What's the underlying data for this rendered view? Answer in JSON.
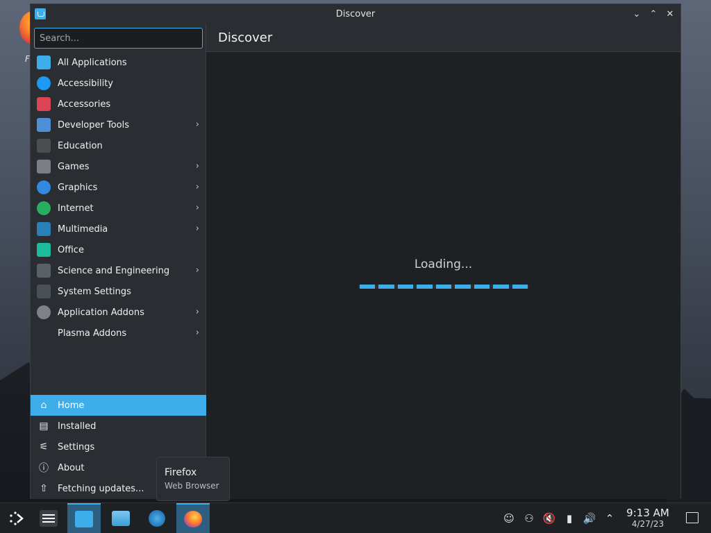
{
  "window": {
    "title": "Discover",
    "controls": {
      "minimize": "⌄",
      "maximize": "⌃",
      "close": "✕"
    }
  },
  "sidebar": {
    "search_placeholder": "Search...",
    "categories": [
      {
        "label": "All Applications",
        "icon": "grid-icon",
        "color": "#3daee9",
        "has_children": false
      },
      {
        "label": "Accessibility",
        "icon": "accessibility-icon",
        "color": "#1d99f3",
        "has_children": false
      },
      {
        "label": "Accessories",
        "icon": "toolbox-icon",
        "color": "#da4453",
        "has_children": false
      },
      {
        "label": "Developer Tools",
        "icon": "hammer-icon",
        "color": "#4f8fd8",
        "has_children": true
      },
      {
        "label": "Education",
        "icon": "chalkboard-icon",
        "color": "#4d4d4d",
        "has_children": false
      },
      {
        "label": "Games",
        "icon": "gamepad-icon",
        "color": "#7a7f85",
        "has_children": true
      },
      {
        "label": "Graphics",
        "icon": "graphics-icon",
        "color": "#2f8ae0",
        "has_children": true
      },
      {
        "label": "Internet",
        "icon": "globe-icon",
        "color": "#27ae60",
        "has_children": true
      },
      {
        "label": "Multimedia",
        "icon": "multimedia-icon",
        "color": "#2980b9",
        "has_children": true
      },
      {
        "label": "Office",
        "icon": "office-icon",
        "color": "#1abc9c",
        "has_children": false
      },
      {
        "label": "Science and Engineering",
        "icon": "flask-icon",
        "color": "#5a6068",
        "has_children": true
      },
      {
        "label": "System Settings",
        "icon": "settings-sliders-icon",
        "color": "#4a5058",
        "has_children": false
      },
      {
        "label": "Application Addons",
        "icon": "addons-icon",
        "color": "#7d8287",
        "has_children": true
      },
      {
        "label": "Plasma Addons",
        "icon": "plasma-icon",
        "color": "#2a2e32",
        "has_children": true
      }
    ],
    "chevron": "›",
    "bottom_nav": [
      {
        "label": "Home",
        "icon": "home-icon",
        "glyph": "⌂",
        "active": true
      },
      {
        "label": "Installed",
        "icon": "installed-icon",
        "glyph": "▤",
        "active": false
      },
      {
        "label": "Settings",
        "icon": "settings-icon",
        "glyph": "⚟",
        "active": false
      },
      {
        "label": "About",
        "icon": "info-icon",
        "glyph": "ⓘ",
        "active": false
      },
      {
        "label": "Fetching updates...",
        "icon": "update-icon",
        "glyph": "⇧",
        "active": false
      }
    ]
  },
  "main": {
    "page_title": "Discover",
    "loading_text": "Loading..."
  },
  "tooltip": {
    "title": "Firefox",
    "subtitle": "Web Browser"
  },
  "taskbar": {
    "clock_time": "9:13 AM",
    "clock_date": "4/27/23",
    "tray_icons": [
      "user-icon",
      "user-switch-icon",
      "muted-audio-icon",
      "usb-icon",
      "volume-icon",
      "chevron-up-icon"
    ],
    "tray_glyphs": [
      "☺",
      "⚇",
      "🔇",
      "▮",
      "🔊",
      "⌃"
    ]
  },
  "colors": {
    "accent": "#3daee9",
    "window_bg": "#202326",
    "panel_bg": "#2a2e32"
  }
}
